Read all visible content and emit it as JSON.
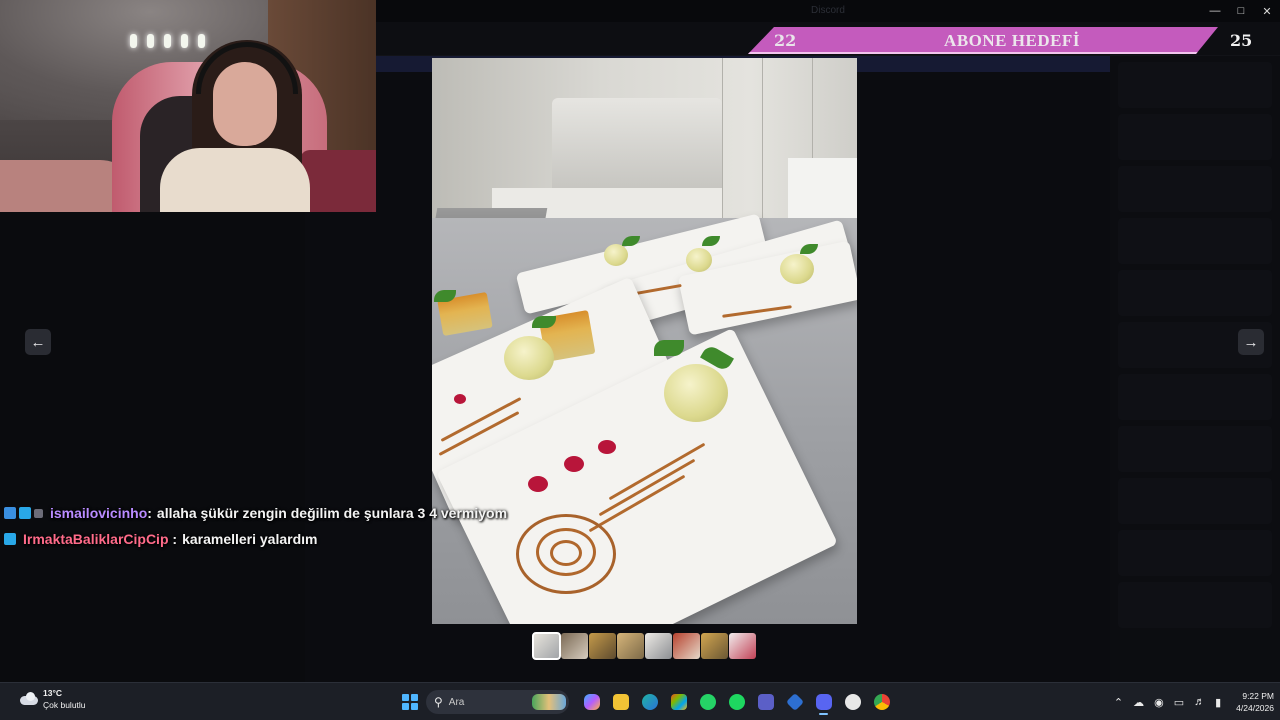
{
  "window": {
    "title": "Discord"
  },
  "subscriber_goal": {
    "current": "22",
    "title": "ABONE HEDEFİ",
    "target": "25"
  },
  "chat": [
    {
      "username": "ismailovicinho",
      "username_color": "#b98bff",
      "message": "allaha şükür zengin değilim de şunlara 3 4 vermiyom",
      "badges": [
        "blue",
        "cyan",
        "gray"
      ]
    },
    {
      "username": "IrmaktaBaliklarCipCip",
      "username_color": "#ff6b8a",
      "message": "karamelleri yalardım",
      "badges": [
        "cyan"
      ]
    }
  ],
  "viewer": {
    "prev_icon": "arrow-left-icon",
    "next_icon": "arrow-right-icon",
    "thumbnail_count": 8,
    "active_thumbnail": 1
  },
  "taskbar": {
    "weather": {
      "temp": "13°C",
      "desc": "Çok bulutlu"
    },
    "search_placeholder": "Ara",
    "apps": [
      "copilot-icon",
      "file-explorer-icon",
      "edge-icon",
      "store-icon",
      "whatsapp-icon",
      "spotify-icon",
      "teams-icon",
      "network-app-icon",
      "discord-icon",
      "steam-icon",
      "chrome-icon"
    ],
    "time": "9:22 PM",
    "date": "4/24/2026"
  },
  "colors": {
    "goal_bar": "#c45bbd",
    "accent": "#5865f2"
  }
}
